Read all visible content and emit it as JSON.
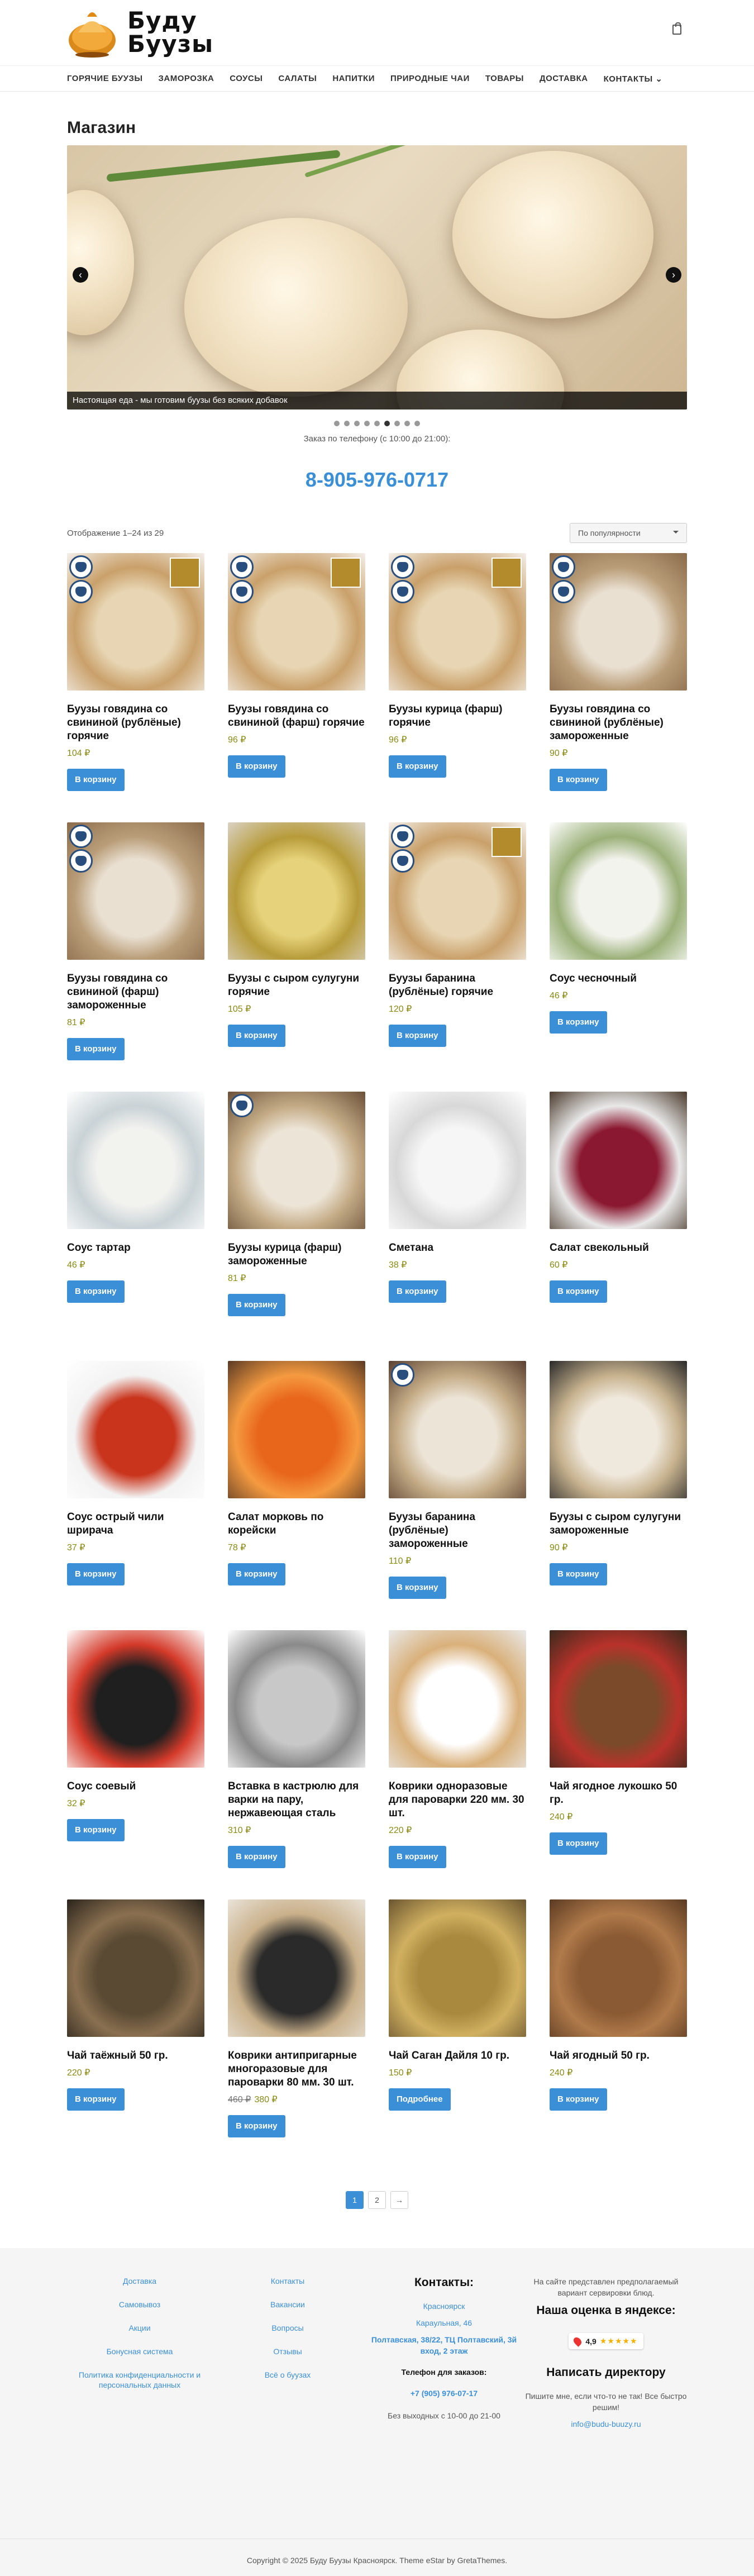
{
  "header": {
    "logo_text_1": "Буду",
    "logo_text_2": "Буузы"
  },
  "nav": [
    "ГОРЯЧИЕ БУУЗЫ",
    "ЗАМОРОЗКА",
    "СОУСЫ",
    "САЛАТЫ",
    "НАПИТКИ",
    "ПРИРОДНЫЕ ЧАИ",
    "ТОВАРЫ",
    "ДОСТАВКА",
    "КОНТАКТЫ ⌄"
  ],
  "page_title": "Магазин",
  "slider": {
    "caption": "Настоящая еда - мы готовим буузы без всяких добавок"
  },
  "order_text": "Заказ по телефону (с 10:00 до 21:00):",
  "phone": "8-905-976-0717",
  "result_count": "Отображение 1–24 из 29",
  "sort": "По популярности",
  "products": [
    {
      "name": "Буузы говядина со свининой (рублёные) горячие",
      "price": "104 ₽",
      "btn": "В корзину"
    },
    {
      "name": "Буузы говядина со свининой (фарш) горячие",
      "price": "96 ₽",
      "btn": "В корзину"
    },
    {
      "name": "Буузы курица (фарш) горячие",
      "price": "96 ₽",
      "btn": "В корзину"
    },
    {
      "name": "Буузы говядина со свининой (рублёные) замороженные",
      "price": "90 ₽",
      "btn": "В корзину"
    },
    {
      "name": "Буузы говядина со свининой (фарш) замороженные",
      "price": "81 ₽",
      "btn": "В корзину"
    },
    {
      "name": "Буузы с сыром сулугуни горячие",
      "price": "105 ₽",
      "btn": "В корзину"
    },
    {
      "name": "Буузы баранина (рублёные) горячие",
      "price": "120 ₽",
      "btn": "В корзину"
    },
    {
      "name": "Соус чесночный",
      "price": "46 ₽",
      "btn": "В корзину"
    },
    {
      "name": "Соус тартар",
      "price": "46 ₽",
      "btn": "В корзину"
    },
    {
      "name": "Буузы курица (фарш) замороженные",
      "price": "81 ₽",
      "btn": "В корзину"
    },
    {
      "name": "Сметана",
      "price": "38 ₽",
      "btn": "В корзину"
    },
    {
      "name": "Салат свекольный",
      "price": "60 ₽",
      "btn": "В корзину"
    },
    {
      "name": "Соус острый чили шрирача",
      "price": "37 ₽",
      "btn": "В корзину"
    },
    {
      "name": "Салат морковь по корейски",
      "price": "78 ₽",
      "btn": "В корзину"
    },
    {
      "name": "Буузы баранина (рублёные) замороженные",
      "price": "110 ₽",
      "btn": "В корзину"
    },
    {
      "name": "Буузы с сыром сулугуни замороженные",
      "price": "90 ₽",
      "btn": "В корзину"
    },
    {
      "name": "Соус соевый",
      "price": "32 ₽",
      "btn": "В корзину"
    },
    {
      "name": "Вставка в кастрюлю для варки на пару, нержавеющая сталь",
      "price": "310 ₽",
      "btn": "В корзину"
    },
    {
      "name": "Коврики одноразовые для пароварки 220 мм. 30 шт.",
      "price": "220 ₽",
      "btn": "В корзину"
    },
    {
      "name": "Чай ягодное лукошко 50 гр.",
      "price": "240 ₽",
      "btn": "В корзину"
    },
    {
      "name": "Чай таёжный 50 гр.",
      "price": "220 ₽",
      "btn": "В корзину"
    },
    {
      "name": "Коврики антипригарные многоразовые для пароварки 80 мм. 30 шт.",
      "old_price": "460 ₽",
      "price": "380 ₽",
      "btn": "В корзину"
    },
    {
      "name": "Чай Саган Дайля 10 гр.",
      "price": "150 ₽",
      "btn": "Подробнее"
    },
    {
      "name": "Чай ягодный 50 гр.",
      "price": "240 ₽",
      "btn": "В корзину"
    }
  ],
  "pagination": [
    "1",
    "2",
    "→"
  ],
  "footer": {
    "col1": [
      "Доставка",
      "Самовывоз",
      "Акции",
      "Бонусная система",
      "Политика конфиденциальности и персональных данных"
    ],
    "col2": [
      "Контакты",
      "Вакансии",
      "Вопросы",
      "Отзывы",
      "Всё о буузах"
    ],
    "contacts_title": "Контакты:",
    "city": "Красноярск",
    "address1": "Карaульная, 46",
    "address2": "Полтавская, 38/22, ТЦ Полтавский, 3й вход, 2 этаж",
    "phone_label": "Телефон для заказов:",
    "phone": "+7 (905) 976-07-17",
    "hours": "Без выходных с 10-00 до 21-00",
    "note": "На сайте представлен предполагаемый вариант сервировки блюд.",
    "yandex_title": "Наша оценка в яндексе:",
    "rating": "4,9",
    "write_title": "Написать директору",
    "write_text": "Пишите мне, если что-то не так! Все быстро решим!",
    "email": "info@budu-buuzy.ru"
  },
  "copyright": "Copyright © 2025 Буду Буузы Красноярск. Theme eStar by GretaThemes."
}
